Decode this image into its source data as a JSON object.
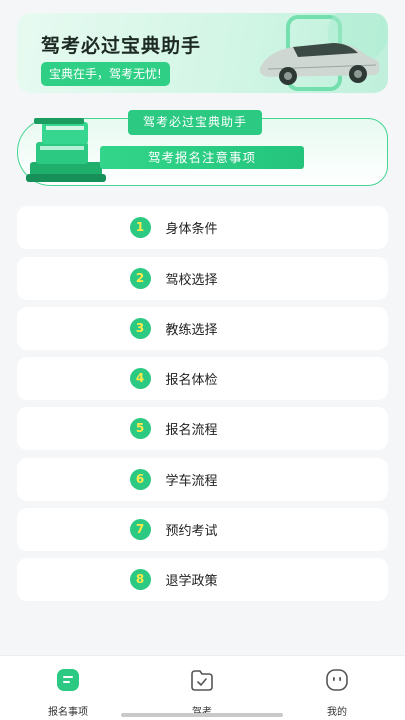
{
  "banner": {
    "title": "驾考必过宝典助手",
    "slogan": "宝典在手，驾考无忧!"
  },
  "notice": {
    "tab_label": "驾考必过宝典助手",
    "bar_label": "驾考报名注意事项"
  },
  "list": [
    {
      "num": "1",
      "label": "身体条件"
    },
    {
      "num": "2",
      "label": "驾校选择"
    },
    {
      "num": "3",
      "label": "教练选择"
    },
    {
      "num": "4",
      "label": "报名体检"
    },
    {
      "num": "5",
      "label": "报名流程"
    },
    {
      "num": "6",
      "label": "学车流程"
    },
    {
      "num": "7",
      "label": "预约考试"
    },
    {
      "num": "8",
      "label": "退学政策"
    }
  ],
  "bottom_nav": [
    {
      "label": "报名事项",
      "icon": "document-icon",
      "active": true
    },
    {
      "label": "驾考",
      "icon": "folder-check-icon",
      "active": false
    },
    {
      "label": "我的",
      "icon": "face-icon",
      "active": false
    }
  ],
  "colors": {
    "accent": "#2bc982",
    "number_text": "#ffe94a",
    "background": "#f5f6f8"
  }
}
